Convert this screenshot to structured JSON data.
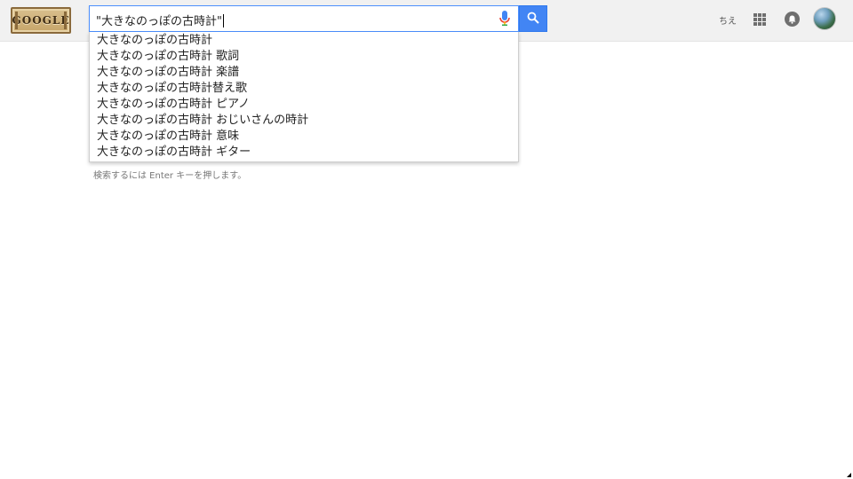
{
  "header": {
    "logo_text": "GOOGLE",
    "user_name": "ちえ"
  },
  "search": {
    "query": "\"大きなのっぽの古時計\"",
    "accent_color": "#4285f4"
  },
  "icons": {
    "mic": "microphone-icon",
    "search": "magnifier-icon",
    "apps": "apps-grid-icon",
    "notifications": "bell-icon",
    "avatar": "profile-avatar"
  },
  "suggestions": [
    "大きなのっぽの古時計",
    "大きなのっぽの古時計 歌詞",
    "大きなのっぽの古時計 楽譜",
    "大きなのっぽの古時計替え歌",
    "大きなのっぽの古時計 ピアノ",
    "大きなのっぽの古時計 おじいさんの時計",
    "大きなのっぽの古時計 意味",
    "大きなのっぽの古時計 ギター"
  ],
  "hint_text": "検索するには Enter キーを押します。"
}
